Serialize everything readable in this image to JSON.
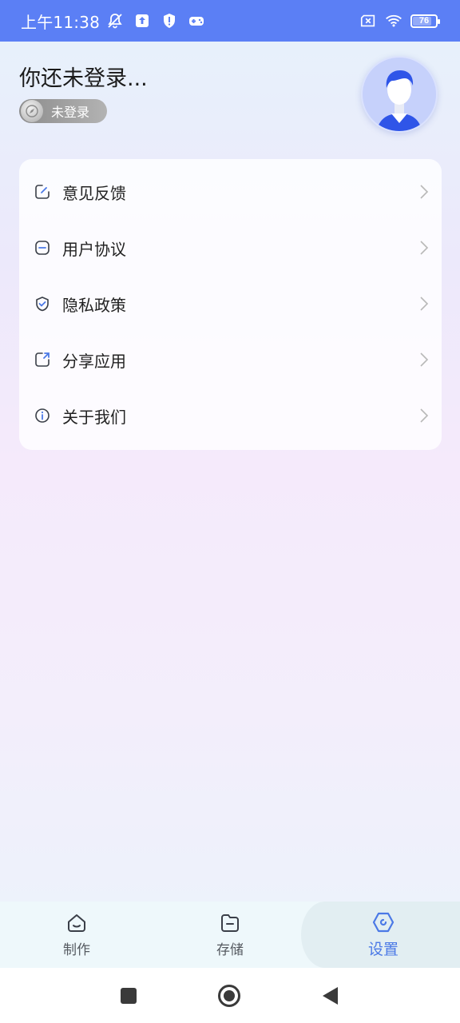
{
  "status_bar": {
    "time": "上午11:38",
    "battery_level": "76",
    "icons": [
      "bell-off-icon",
      "upload-icon",
      "shield-alert-icon",
      "gamepad-icon",
      "sim-off-icon",
      "wifi-icon",
      "battery-icon"
    ]
  },
  "header": {
    "title": "你还未登录...",
    "badge_label": "未登录",
    "avatar_icon": "user-avatar-icon"
  },
  "menu": {
    "items": [
      {
        "label": "意见反馈",
        "icon": "feedback-edit-icon"
      },
      {
        "label": "用户协议",
        "icon": "agreement-icon"
      },
      {
        "label": "隐私政策",
        "icon": "privacy-shield-icon"
      },
      {
        "label": "分享应用",
        "icon": "share-icon"
      },
      {
        "label": "关于我们",
        "icon": "info-icon"
      }
    ]
  },
  "bottom_nav": {
    "tabs": [
      {
        "label": "制作",
        "icon": "home-icon",
        "active": false
      },
      {
        "label": "存储",
        "icon": "folder-icon",
        "active": false
      },
      {
        "label": "设置",
        "icon": "settings-icon",
        "active": true
      }
    ]
  },
  "colors": {
    "status_bar": "#5b7ff5",
    "accent": "#4b79e6",
    "badge_bg": "#9e9e9e",
    "text_primary": "#222222"
  }
}
